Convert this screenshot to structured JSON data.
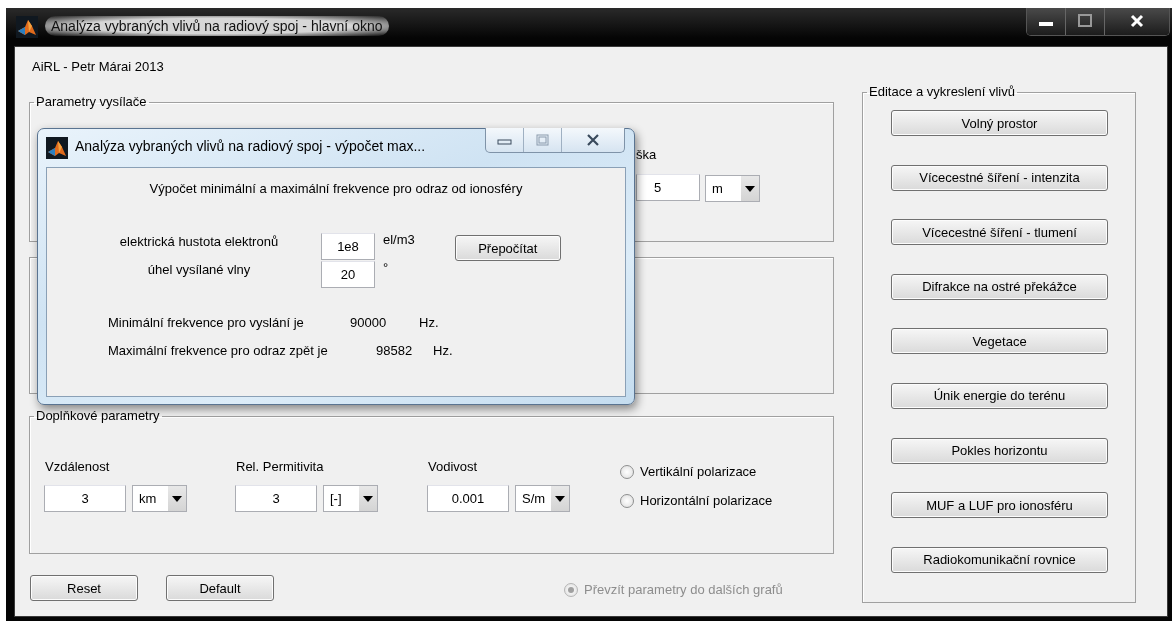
{
  "main_window": {
    "title": "Analýza vybraných vlivů na radiový spoj - hlavní okno",
    "author": "AiRL - Petr Márai 2013",
    "transmitter_panel": {
      "title": "Parametry vysílače",
      "field_label": "ška",
      "field_value": "5",
      "unit": "m"
    },
    "additional_panel": {
      "title": "Doplňkové parametry",
      "params": [
        {
          "label": "Vzdálenost",
          "value": "3",
          "unit": "km"
        },
        {
          "label": "Rel. Permitivita",
          "value": "3",
          "unit": "[-]"
        },
        {
          "label": "Vodivost",
          "value": "0.001",
          "unit": "S/m"
        }
      ],
      "polarization": [
        {
          "label": "Vertikální polarizace",
          "selected": false
        },
        {
          "label": "Horizontální polarizace",
          "selected": false
        }
      ]
    },
    "buttons": [
      "Reset",
      "Default"
    ],
    "adopt_option": {
      "label": "Převzít parametry do dalších grafů",
      "selected": true,
      "disabled": true
    },
    "effects_panel": {
      "title": "Editace a vykreslení vlivů",
      "buttons": [
        "Volný prostor",
        "Vícecestné šíření - intenzita",
        "Vícecestné šíření - tlumení",
        "Difrakce na ostré překážce",
        "Vegetace",
        "Únik energie do terénu",
        "Pokles horizontu",
        "MUF a LUF pro ionosféru",
        "Radiokomunikační rovnice"
      ]
    }
  },
  "dialog": {
    "title": "Analýza vybraných vlivů na radiový spoj - výpočet max...",
    "heading": "Výpočet minimální a maximální frekvence pro odraz od ionosféry",
    "inputs": [
      {
        "label": "elektrická hustota elektronů",
        "value": "1e8",
        "unit": "el/m3"
      },
      {
        "label": "úhel vysílané vlny",
        "value": "20",
        "unit": "°"
      }
    ],
    "recalc_button": "Přepočítat",
    "results": [
      {
        "label": "Minimální frekvence pro vyslání je",
        "value": "90000",
        "unit": "Hz."
      },
      {
        "label": "Maximální frekvence pro odraz zpět je",
        "value": "98582",
        "unit": "Hz."
      }
    ]
  }
}
